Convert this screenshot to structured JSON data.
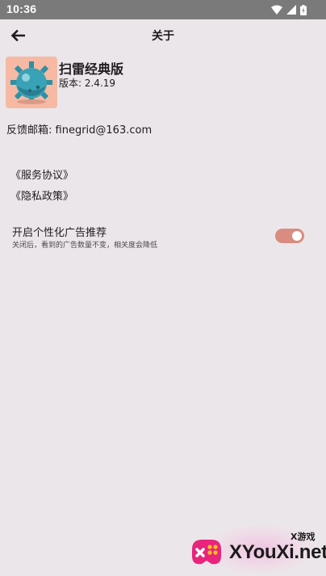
{
  "status_bar": {
    "time": "10:36",
    "icons": [
      "wifi-icon",
      "signal-icon",
      "battery-icon"
    ]
  },
  "app_bar": {
    "back_icon": "arrow-back-icon",
    "title": "关于"
  },
  "app_info": {
    "icon": "mine-icon",
    "name": "扫雷经典版",
    "version": "版本: 2.4.19"
  },
  "feedback": {
    "text": "反馈邮箱: finegrid@163.com"
  },
  "links": {
    "service": "《服务协议》",
    "privacy": "《隐私政策》"
  },
  "ad_setting": {
    "title": "开启个性化广告推荐",
    "description": "关闭后，看到的广告数量不变，相关度会降低",
    "enabled": true
  },
  "watermark": {
    "small_text": "X游戏",
    "big_text": "XYouXi.net"
  },
  "colors": {
    "background": "#ebe6e9",
    "status_bar": "#7a7a7a",
    "toggle_track": "#d98c80",
    "icon_background": "#f5b9a4",
    "mine": "#2f8fa3"
  }
}
